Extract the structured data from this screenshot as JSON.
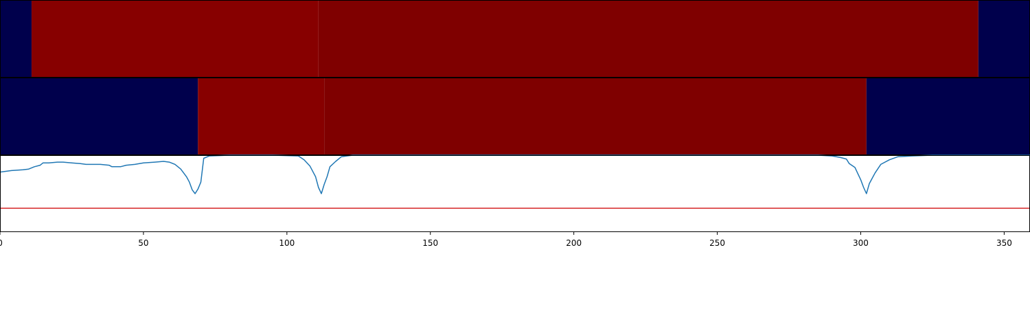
{
  "chart_data": [
    {
      "type": "heatmap",
      "panel": "row-1",
      "x_extent": [
        0,
        359
      ],
      "segments": [
        {
          "x0": 0,
          "x1": 11,
          "color": "#00004c"
        },
        {
          "x0": 11,
          "x1": 111,
          "color": "#870000"
        },
        {
          "x0": 111,
          "x1": 341,
          "color": "#7f0000"
        },
        {
          "x0": 341,
          "x1": 359,
          "color": "#00004c"
        }
      ]
    },
    {
      "type": "heatmap",
      "panel": "row-2",
      "x_extent": [
        0,
        359
      ],
      "segments": [
        {
          "x0": 0,
          "x1": 69,
          "color": "#00004c"
        },
        {
          "x0": 69,
          "x1": 113,
          "color": "#870000"
        },
        {
          "x0": 113,
          "x1": 302,
          "color": "#7f0000"
        },
        {
          "x0": 302,
          "x1": 359,
          "color": "#00004c"
        }
      ]
    },
    {
      "type": "line",
      "panel": "line",
      "xlim": [
        0,
        359
      ],
      "ylim": [
        0,
        1
      ],
      "grid": false,
      "xticks": [
        "0",
        "50",
        "100",
        "150",
        "200",
        "250",
        "300",
        "350"
      ],
      "xtick_values": [
        0,
        50,
        100,
        150,
        200,
        250,
        300,
        350
      ],
      "series": [
        {
          "color": "#1f77b4",
          "points": [
            [
              0,
              0.78
            ],
            [
              2,
              0.79
            ],
            [
              4,
              0.8
            ],
            [
              8,
              0.81
            ],
            [
              10,
              0.82
            ],
            [
              12,
              0.85
            ],
            [
              14,
              0.87
            ],
            [
              15,
              0.9
            ],
            [
              17,
              0.9
            ],
            [
              20,
              0.91
            ],
            [
              22,
              0.91
            ],
            [
              25,
              0.9
            ],
            [
              28,
              0.89
            ],
            [
              30,
              0.88
            ],
            [
              35,
              0.88
            ],
            [
              38,
              0.87
            ],
            [
              39,
              0.85
            ],
            [
              42,
              0.85
            ],
            [
              44,
              0.87
            ],
            [
              47,
              0.88
            ],
            [
              50,
              0.9
            ],
            [
              54,
              0.91
            ],
            [
              57,
              0.92
            ],
            [
              59,
              0.91
            ],
            [
              61,
              0.88
            ],
            [
              63,
              0.82
            ],
            [
              65,
              0.72
            ],
            [
              66,
              0.65
            ],
            [
              67,
              0.55
            ],
            [
              68,
              0.5
            ],
            [
              69,
              0.56
            ],
            [
              70,
              0.65
            ],
            [
              71,
              0.96
            ],
            [
              73,
              0.99
            ],
            [
              80,
              1.0
            ],
            [
              95,
              1.0
            ],
            [
              104,
              0.99
            ],
            [
              106,
              0.94
            ],
            [
              108,
              0.86
            ],
            [
              110,
              0.72
            ],
            [
              111,
              0.58
            ],
            [
              112,
              0.5
            ],
            [
              113,
              0.62
            ],
            [
              114,
              0.72
            ],
            [
              115,
              0.85
            ],
            [
              117,
              0.92
            ],
            [
              119,
              0.98
            ],
            [
              123,
              1.0
            ],
            [
              150,
              1.0
            ],
            [
              200,
              1.0
            ],
            [
              260,
              1.0
            ],
            [
              285,
              1.0
            ],
            [
              290,
              0.99
            ],
            [
              293,
              0.97
            ],
            [
              295,
              0.95
            ],
            [
              296,
              0.89
            ],
            [
              298,
              0.84
            ],
            [
              299,
              0.76
            ],
            [
              300,
              0.68
            ],
            [
              301,
              0.58
            ],
            [
              302,
              0.5
            ],
            [
              303,
              0.63
            ],
            [
              305,
              0.77
            ],
            [
              307,
              0.88
            ],
            [
              310,
              0.94
            ],
            [
              313,
              0.98
            ],
            [
              318,
              0.99
            ],
            [
              325,
              1.0
            ],
            [
              359,
              1.0
            ]
          ]
        },
        {
          "color": "#d62728",
          "points": [
            [
              0,
              0.31
            ],
            [
              359,
              0.31
            ]
          ]
        }
      ]
    }
  ]
}
